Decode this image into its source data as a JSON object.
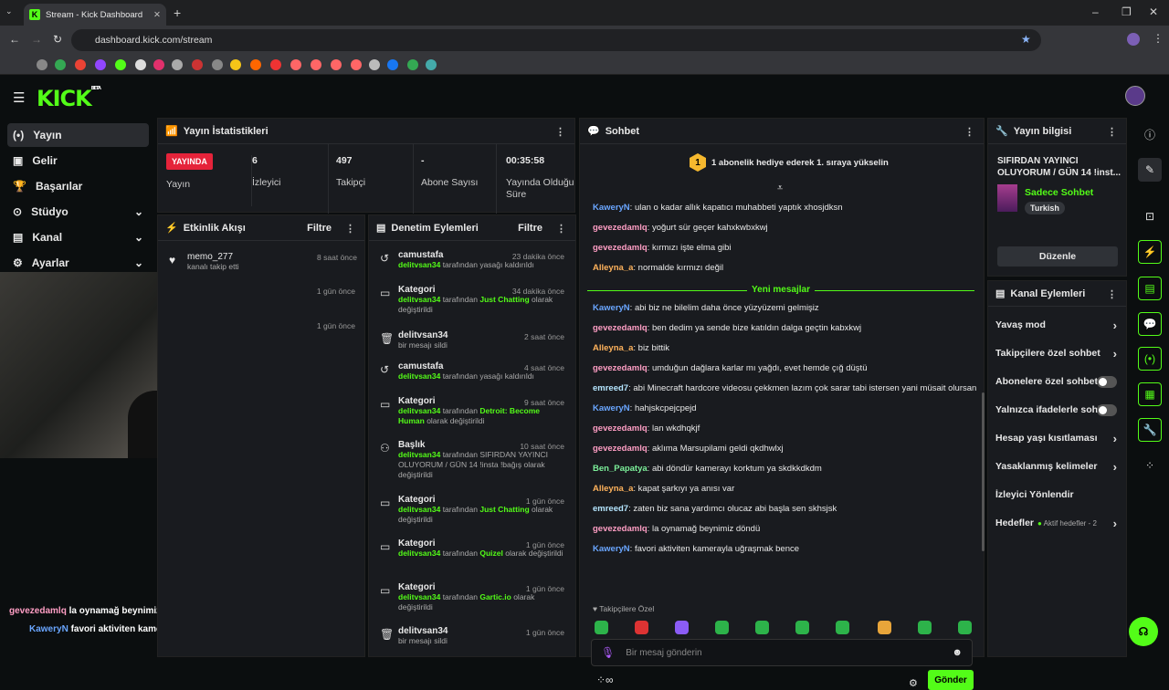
{
  "browser": {
    "tab_title": "Stream - Kick Dashboard",
    "url": "dashboard.kick.com/stream"
  },
  "brand": {
    "logo": "KICK",
    "badge": "BETA",
    "accent": "#53fc18"
  },
  "nav": [
    {
      "label": "Yayın",
      "icon": "broadcast-icon"
    },
    {
      "label": "Gelir",
      "icon": "revenue-icon"
    },
    {
      "label": "Başarılar",
      "icon": "trophy-icon"
    },
    {
      "label": "Stüdyo",
      "icon": "studio-icon"
    },
    {
      "label": "Kanal",
      "icon": "channel-icon"
    },
    {
      "label": "Ayarlar",
      "icon": "gear-icon"
    }
  ],
  "stats": {
    "title": "Yayın İstatistikleri",
    "live": "YAYINDA",
    "live_label": "Yayın",
    "items": [
      {
        "value": "6",
        "label": "İzleyici"
      },
      {
        "value": "497",
        "label": "Takipçi"
      },
      {
        "value": "-",
        "label": "Abone Sayısı"
      },
      {
        "value": "00:35:58",
        "label": "Yayında Olduğu Süre"
      }
    ]
  },
  "activity": {
    "title": "Etkinlik Akışı",
    "filter": "Filtre",
    "events": [
      {
        "name": "memo_277",
        "sub": "kanalı takip etti",
        "time": "8 saat önce"
      },
      {
        "time": "1 gün önce"
      },
      {
        "time": "1 gün önce"
      }
    ]
  },
  "mod": {
    "title": "Denetim Eylemleri",
    "filter": "Filtre",
    "events": [
      {
        "title": "camustafa",
        "user": "delitvsan34",
        "text": "tarafından yasağı kaldırıldı",
        "time": "23 dakika önce",
        "icon": "undo-icon"
      },
      {
        "title": "Kategori",
        "user": "delitvsan34",
        "text": "tarafından",
        "green": "Just Chatting",
        "tail": "olarak değiştirildi",
        "time": "34 dakika önce",
        "icon": "category-icon"
      },
      {
        "title": "delitvsan34",
        "text": "bir mesajı sildi",
        "time": "2 saat önce",
        "icon": "trash-icon"
      },
      {
        "title": "camustafa",
        "user": "delitvsan34",
        "text": "tarafından yasağı kaldırıldı",
        "time": "4 saat önce",
        "icon": "undo-icon"
      },
      {
        "title": "Kategori",
        "user": "delitvsan34",
        "text": "tarafından",
        "green": "Detroit: Become Human",
        "tail": "olarak değiştirildi",
        "time": "9 saat önce",
        "icon": "category-icon"
      },
      {
        "title": "Başlık",
        "user": "delitvsan34",
        "text": "tarafından SIFIRDAN YAYINCI OLUYORUM / GÜN 14 !insta !bağış olarak değiştirildi",
        "time": "10 saat önce",
        "icon": "title-icon"
      },
      {
        "title": "Kategori",
        "user": "delitvsan34",
        "text": "tarafından",
        "green": "Just Chatting",
        "tail": "olarak değiştirildi",
        "time": "1 gün önce",
        "icon": "category-icon"
      },
      {
        "title": "Kategori",
        "user": "delitvsan34",
        "text": "tarafından",
        "green": "Quizel",
        "tail": "olarak değiştirildi",
        "time": "1 gün önce",
        "icon": "category-icon"
      },
      {
        "title": "Kategori",
        "user": "delitvsan34",
        "text": "tarafından",
        "green": "Gartic.io",
        "tail": "olarak değiştirildi",
        "time": "1 gün önce",
        "icon": "category-icon"
      },
      {
        "title": "delitvsan34",
        "text": "bir mesajı sildi",
        "time": "1 gün önce",
        "icon": "trash-icon"
      }
    ]
  },
  "chat": {
    "title": "Sohbet",
    "gift_banner": "1 abonelik hediye ederek 1. sıraya yükselin",
    "new_messages": "Yeni mesajlar",
    "followers_only": "Takipçilere Özel",
    "placeholder": "Bir mesaj gönderin",
    "send": "Gönder",
    "messages": [
      {
        "user": "KaweryN",
        "color": "#6aa6ff",
        "text": "ulan o kadar allık kapatıcı muhabbeti yaptık xhosjdksn"
      },
      {
        "user": "gevezedamlq",
        "color": "#ff9ec4",
        "text": "yoğurt sür geçer kahxkwbxkwj"
      },
      {
        "user": "gevezedamlq",
        "color": "#ff9ec4",
        "text": "kırmızı işte elma gibi"
      },
      {
        "user": "Alleyna_a",
        "color": "#ffb35c",
        "text": "normalde kırmızı değil"
      },
      {
        "user": "KaweryN",
        "color": "#6aa6ff",
        "text": "abi biz ne bilelim daha önce yüzyüzemi gelmişiz"
      },
      {
        "user": "gevezedamlq",
        "color": "#ff9ec4",
        "text": "ben dedim ya sende bize katıldın dalga geçtin kabxkwj"
      },
      {
        "user": "Alleyna_a",
        "color": "#ffb35c",
        "text": "biz bittik"
      },
      {
        "user": "gevezedamlq",
        "color": "#ff9ec4",
        "text": "umduğun dağlara karlar mı yağdı, evet hemde çığ düştü"
      },
      {
        "user": "emreed7",
        "color": "#b5e6ff",
        "text": "abi Minecraft hardcore videosu çekkmen lazım çok sarar tabi istersen yani müsait olursan"
      },
      {
        "user": "KaweryN",
        "color": "#6aa6ff",
        "text": "hahjskcpejcpejd"
      },
      {
        "user": "gevezedamlq",
        "color": "#ff9ec4",
        "text": "lan wkdhqkjf"
      },
      {
        "user": "gevezedamlq",
        "color": "#ff9ec4",
        "text": "aklıma Marsupilami geldi qkdhwlxj"
      },
      {
        "user": "Ben_Papatya",
        "color": "#7cf09a",
        "text": "abi döndür kamerayı korktum ya skdkkdkdm"
      },
      {
        "user": "Alleyna_a",
        "color": "#ffb35c",
        "text": "kapat şarkıyı ya anısı var"
      },
      {
        "user": "emreed7",
        "color": "#b5e6ff",
        "text": "zaten biz sana yardımcı olucaz abi başla sen skhsjsk"
      },
      {
        "user": "gevezedamlq",
        "color": "#ff9ec4",
        "text": "la oynamağ beynimiz döndü"
      },
      {
        "user": "KaweryN",
        "color": "#6aa6ff",
        "text": "favori aktiviten kamerayla uğraşmak bence"
      }
    ]
  },
  "overlay": [
    {
      "user": "gevezedamlq",
      "color": "#ff9ec4",
      "text": "la oynamağ beynimiz döndü"
    },
    {
      "user": "KaweryN",
      "color": "#6aa6ff",
      "text": "favori aktiviten kamerayla uğraşmak bence"
    }
  ],
  "info": {
    "title": "Yayın bilgisi",
    "stream_title": "SIFIRDAN YAYINCI OLUYORUM / GÜN 14 !inst...",
    "category": "Sadece Sohbet",
    "language": "Turkish",
    "edit": "Düzenle"
  },
  "actions": {
    "title": "Kanal Eylemleri",
    "items": [
      {
        "label": "Yavaş mod",
        "kind": "chev"
      },
      {
        "label": "Takipçilere özel sohbet",
        "kind": "chev"
      },
      {
        "label": "Abonelere özel sohbet",
        "kind": "toggle"
      },
      {
        "label": "Yalnızca ifadelerle sohbet",
        "kind": "toggle"
      },
      {
        "label": "Hesap yaşı kısıtlaması",
        "kind": "chev"
      },
      {
        "label": "Yasaklanmış kelimeler",
        "kind": "chev"
      },
      {
        "label": "İzleyici Yönlendir",
        "kind": "none"
      },
      {
        "label": "Hedefler",
        "kind": "chev",
        "extra": "Aktif hedefler - 2"
      }
    ]
  }
}
